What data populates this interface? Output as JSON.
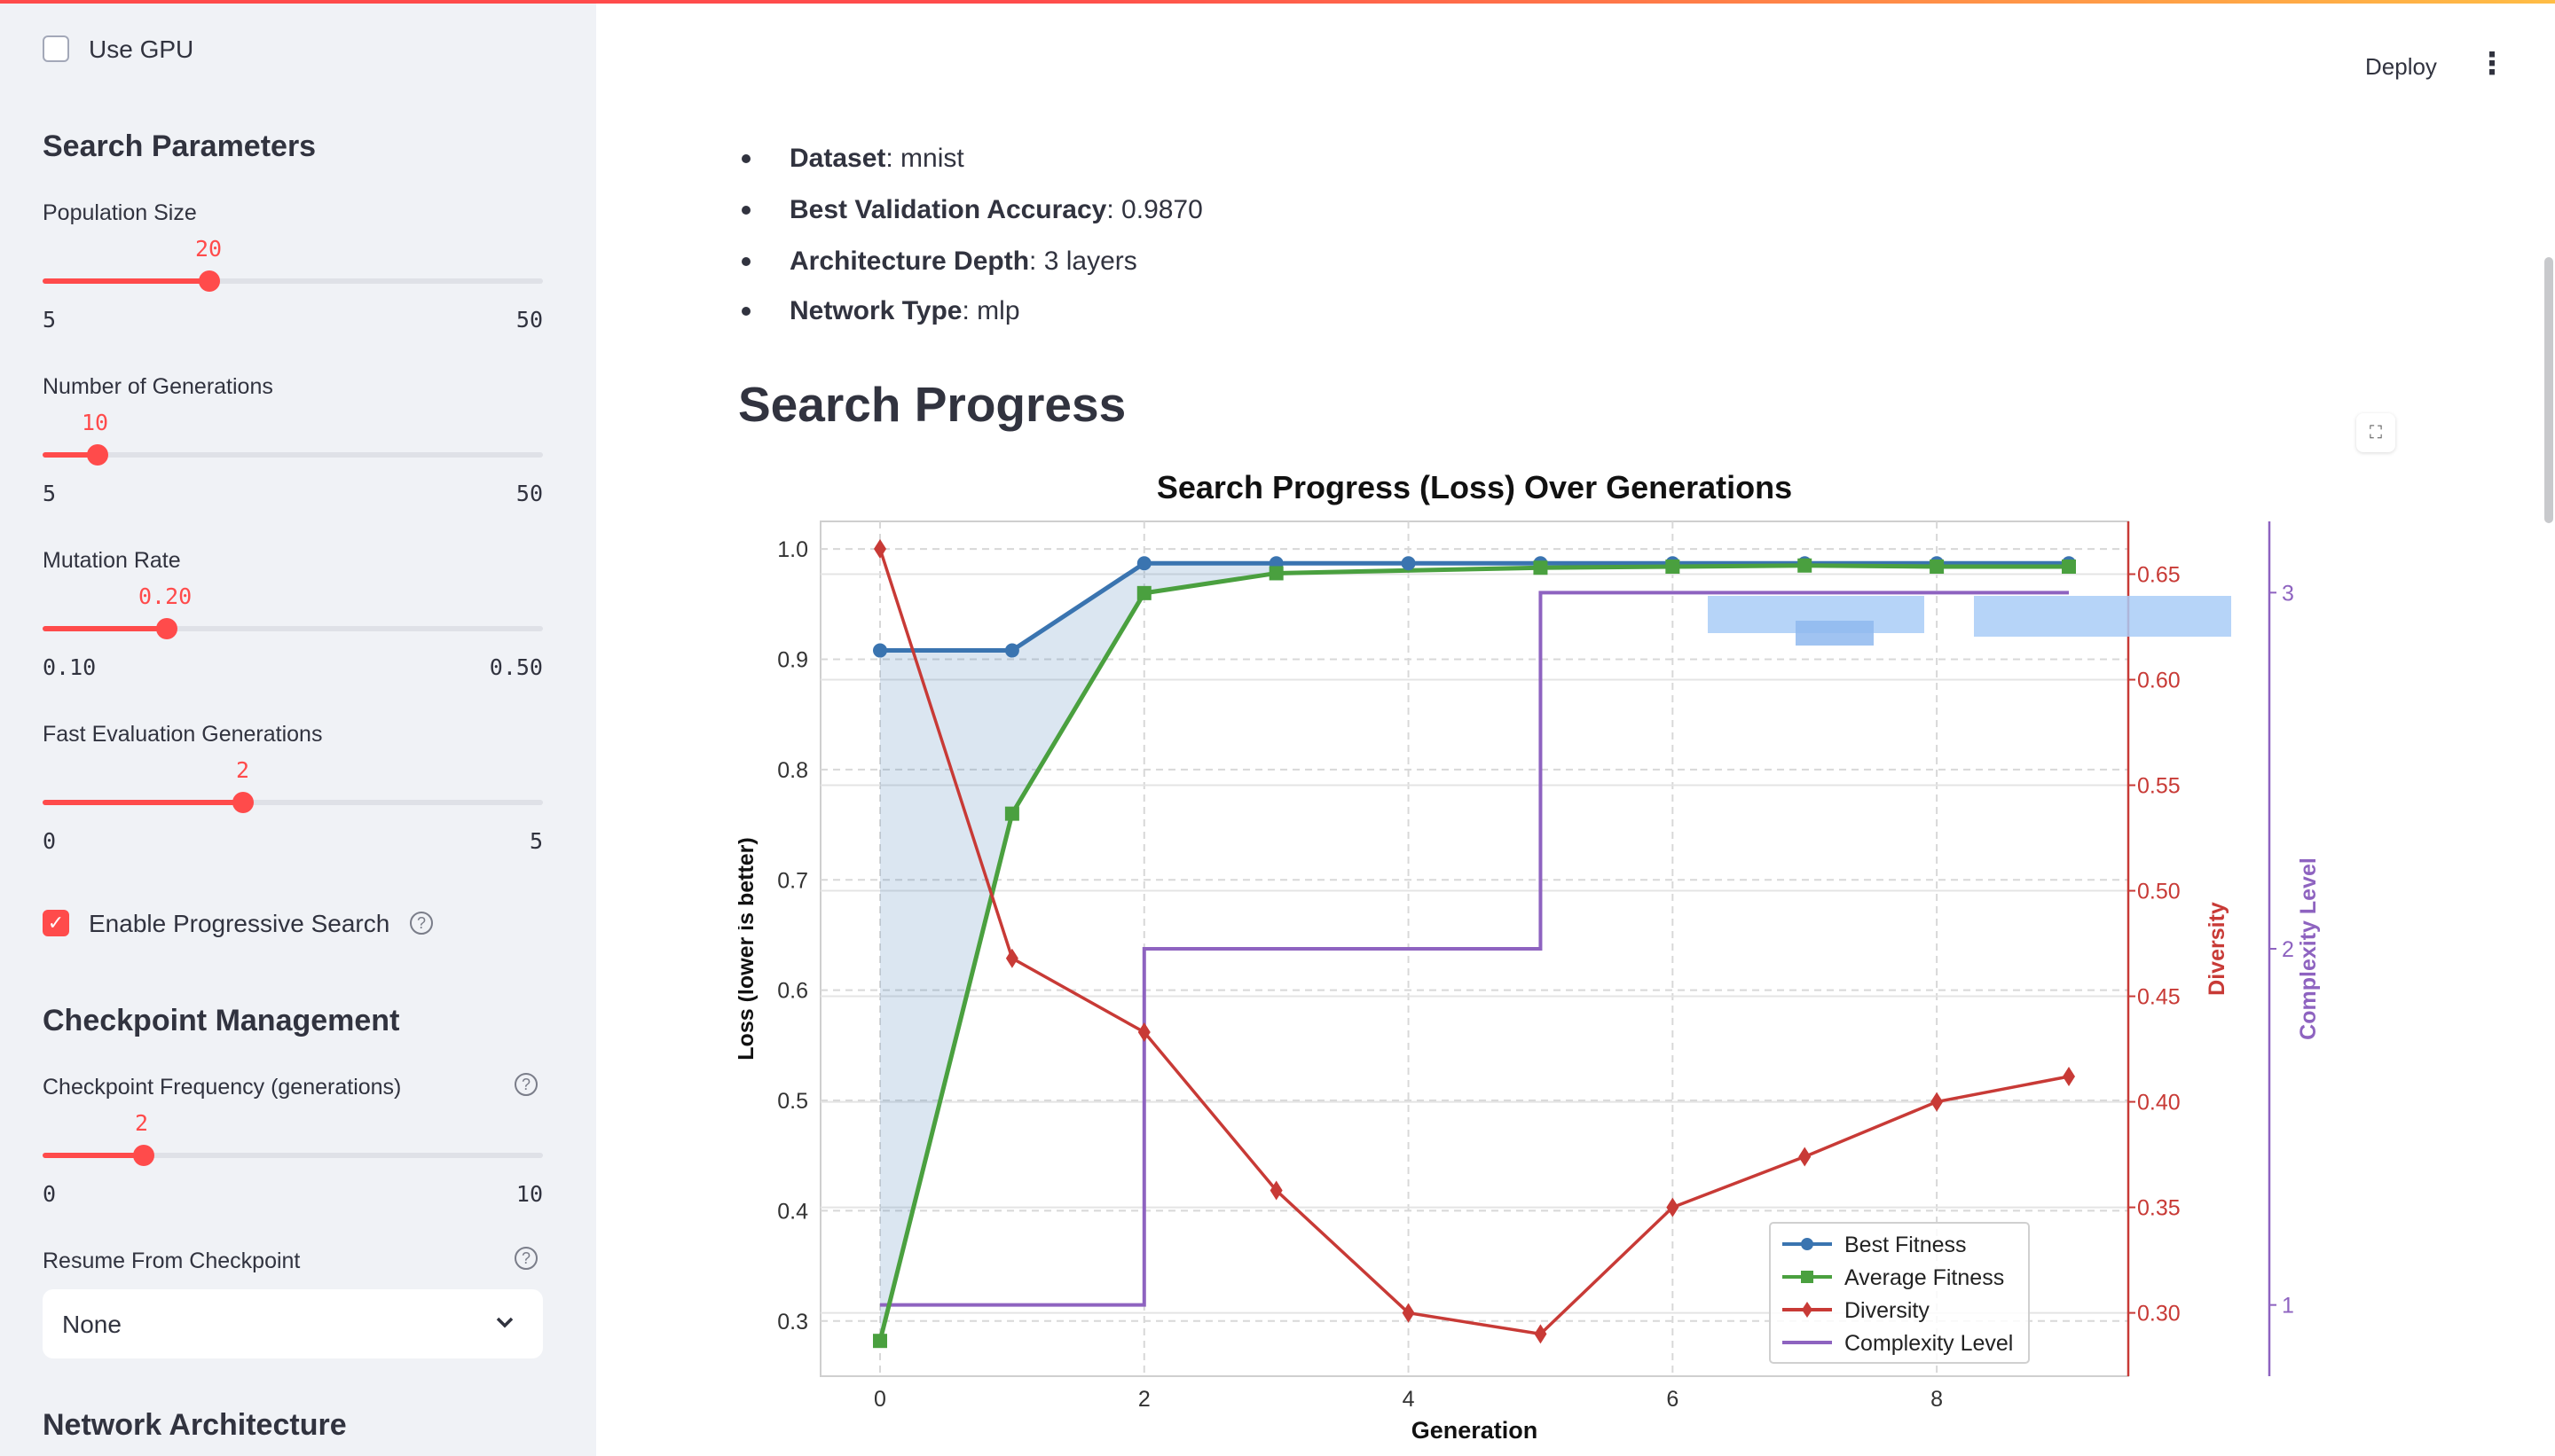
{
  "sidebar": {
    "use_gpu": {
      "label": "Use GPU",
      "checked": false
    },
    "search_parameters_header": "Search Parameters",
    "population_size": {
      "label": "Population Size",
      "value": "20",
      "min": "5",
      "max": "50"
    },
    "num_generations": {
      "label": "Number of Generations",
      "value": "10",
      "min": "5",
      "max": "50"
    },
    "mutation_rate": {
      "label": "Mutation Rate",
      "value": "0.20",
      "min": "0.10",
      "max": "0.50"
    },
    "fast_eval": {
      "label": "Fast Evaluation Generations",
      "value": "2",
      "min": "0",
      "max": "5"
    },
    "progressive_search": {
      "label": "Enable Progressive Search",
      "checked": true
    },
    "checkpoint_header": "Checkpoint Management",
    "checkpoint_frequency": {
      "label": "Checkpoint Frequency (generations)",
      "value": "2",
      "min": "0",
      "max": "10"
    },
    "resume": {
      "label": "Resume From Checkpoint",
      "selected": "None"
    },
    "network_architecture_header": "Network Architecture"
  },
  "header": {
    "deploy_label": "Deploy"
  },
  "summary": [
    {
      "key": "Dataset",
      "value": ": mnist"
    },
    {
      "key": "Best Validation Accuracy",
      "value": ": 0.9870"
    },
    {
      "key": "Architecture Depth",
      "value": ": 3 layers"
    },
    {
      "key": "Network Type",
      "value": ": mlp"
    }
  ],
  "section_title": "Search Progress",
  "colors": {
    "accent": "#ff4b4b",
    "best": "#3a74b0",
    "avg": "#4aa03f",
    "diversity": "#c83a36",
    "complexity": "#8e63c0"
  },
  "chart_data": {
    "type": "line",
    "title": "Search Progress (Loss) Over Generations",
    "xlabel": "Generation",
    "ylabel": "Loss (lower is better)",
    "y2label": "Diversity",
    "y3label": "Complexity Level",
    "xlim": [
      -0.45,
      9.45
    ],
    "ylim": [
      0.25,
      1.025
    ],
    "y2lim": [
      0.27,
      0.675
    ],
    "y3lim": [
      0.8,
      3.2
    ],
    "x_ticks": [
      "0",
      "2",
      "4",
      "6",
      "8"
    ],
    "y_ticks": [
      "0.3",
      "0.4",
      "0.5",
      "0.6",
      "0.7",
      "0.8",
      "0.9",
      "1.0"
    ],
    "y2_ticks": [
      "0.30",
      "0.35",
      "0.40",
      "0.45",
      "0.50",
      "0.55",
      "0.60",
      "0.65"
    ],
    "y3_ticks": [
      "1",
      "2",
      "3"
    ],
    "x": [
      0,
      1,
      2,
      3,
      4,
      5,
      6,
      7,
      8,
      9
    ],
    "series": [
      {
        "name": "Best Fitness",
        "axis": "left",
        "x": [
          0,
          1,
          2,
          3,
          4,
          5,
          6,
          7,
          8,
          9
        ],
        "values": [
          0.908,
          0.908,
          0.987,
          0.987,
          0.987,
          0.987,
          0.987,
          0.987,
          0.987,
          0.987
        ],
        "marker": "circle"
      },
      {
        "name": "Average Fitness",
        "axis": "left",
        "x": [
          0,
          1,
          2,
          3,
          5,
          6,
          7,
          8,
          9
        ],
        "values": [
          0.282,
          0.76,
          0.96,
          0.978,
          0.983,
          0.984,
          0.985,
          0.984,
          0.984
        ],
        "marker": "square"
      },
      {
        "name": "Diversity",
        "axis": "right",
        "x": [
          0,
          1,
          2,
          3,
          4,
          5,
          6,
          7,
          8,
          9
        ],
        "values": [
          0.662,
          0.468,
          0.433,
          0.358,
          0.3,
          0.29,
          0.35,
          0.374,
          0.4,
          0.412
        ],
        "marker": "diamond"
      },
      {
        "name": "Complexity Level",
        "axis": "right2",
        "x": [
          0,
          2,
          5,
          9
        ],
        "values": [
          1,
          2,
          3,
          3
        ],
        "step": true
      }
    ],
    "legend": "lower-right",
    "grid": true
  }
}
